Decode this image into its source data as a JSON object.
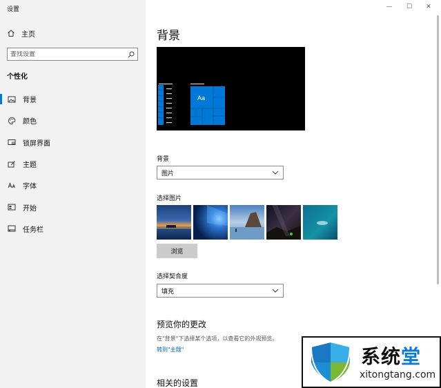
{
  "window": {
    "title": "设置",
    "controls": {
      "minimize": "—",
      "maximize": "☐",
      "close": "✕"
    }
  },
  "sidebar": {
    "home_label": "主页",
    "search_placeholder": "查找设置",
    "section_title": "个性化",
    "items": [
      {
        "label": "背景",
        "icon": "picture-icon",
        "active": true
      },
      {
        "label": "颜色",
        "icon": "palette-icon"
      },
      {
        "label": "锁屏界面",
        "icon": "lock-screen-icon"
      },
      {
        "label": "主题",
        "icon": "theme-icon"
      },
      {
        "label": "字体",
        "icon": "font-icon"
      },
      {
        "label": "开始",
        "icon": "start-icon"
      },
      {
        "label": "任务栏",
        "icon": "taskbar-icon"
      }
    ]
  },
  "main": {
    "title": "背景",
    "preview_tile_text": "Aa",
    "background_label": "背景",
    "background_value": "图片",
    "choose_picture_label": "选择图片",
    "browse_label": "浏览",
    "fit_label": "选择契合度",
    "fit_value": "填充",
    "preview_changes_title": "预览你的更改",
    "preview_changes_desc": "在\"背景\"下选择某个选项，以查看它的外观预览。",
    "theme_link": "转到\"主题\"",
    "related_title": "相关的设置"
  },
  "watermark": {
    "chars": "系统",
    "dot_char": "堂",
    "domain": "xitongtang.com"
  },
  "colors": {
    "accent": "#0078d7",
    "link": "#0067b8",
    "sidebar_bg": "#f2f2f2"
  }
}
